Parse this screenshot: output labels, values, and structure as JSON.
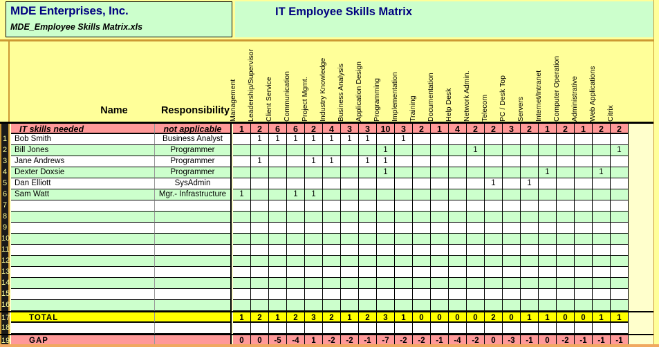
{
  "header": {
    "company_name": "MDE Enterprises, Inc.",
    "file_name": "MDE_Employee Skills Matrix.xls",
    "matrix_title": "IT Employee Skills Matrix"
  },
  "columns": {
    "name_label": "Name",
    "responsibility_label": "Responsibility",
    "skills": [
      "Management",
      "Leadership/Supervisor",
      "Client Service",
      "Communication",
      "Project Mgmt.",
      "Industry Knowledge",
      "Business Analysis",
      "Application Design",
      "Programming",
      "Implementation",
      "Training",
      "Documentation",
      "Help Desk",
      "Network Admin.",
      "Telecom",
      "PC / Desk Top",
      "Servers",
      "Internet/Intranet",
      "Computer Operation",
      "Administrative",
      "Web Applications",
      "Citrix"
    ]
  },
  "needed_row": {
    "row_number": "",
    "name": "IT skills needed",
    "responsibility": "not applicable",
    "values": [
      "1",
      "2",
      "6",
      "6",
      "2",
      "4",
      "3",
      "3",
      "10",
      "3",
      "2",
      "1",
      "4",
      "2",
      "2",
      "3",
      "2",
      "1",
      "2",
      "1",
      "2",
      "2"
    ]
  },
  "employees": [
    {
      "row_number": "1",
      "name": "Bob Smith",
      "responsibility": "Business Analyst",
      "values": [
        "",
        "1",
        "1",
        "1",
        "1",
        "1",
        "1",
        "1",
        "",
        "1",
        "",
        "",
        "",
        "",
        "",
        "",
        "",
        "",
        "",
        "",
        "",
        ""
      ]
    },
    {
      "row_number": "2",
      "name": "Bill Jones",
      "responsibility": "Programmer",
      "values": [
        "",
        "",
        "",
        "",
        "",
        "",
        "",
        "",
        "1",
        "",
        "",
        "",
        "",
        "1",
        "",
        "",
        "",
        "",
        "",
        "",
        "",
        "1"
      ]
    },
    {
      "row_number": "3",
      "name": "Jane Andrews",
      "responsibility": "Programmer",
      "values": [
        "",
        "1",
        "",
        "",
        "1",
        "1",
        "",
        "1",
        "1",
        "",
        "",
        "",
        "",
        "",
        "",
        "",
        "",
        "",
        "",
        "",
        "",
        ""
      ]
    },
    {
      "row_number": "4",
      "name": "Dexter Doxsie",
      "responsibility": "Programmer",
      "values": [
        "",
        "",
        "",
        "",
        "",
        "",
        "",
        "",
        "1",
        "",
        "",
        "",
        "",
        "",
        "",
        "",
        "",
        "1",
        "",
        "",
        "1",
        ""
      ]
    },
    {
      "row_number": "5",
      "name": "Dan Elliott",
      "responsibility": "SysAdmin",
      "values": [
        "",
        "",
        "",
        "",
        "",
        "",
        "",
        "",
        "",
        "",
        "",
        "",
        "",
        "",
        "1",
        "",
        "1",
        "",
        "",
        "",
        "",
        ""
      ]
    },
    {
      "row_number": "6",
      "name": "Sam Watt",
      "responsibility": "Mgr.- Infrastructure",
      "values": [
        "1",
        "",
        "",
        "1",
        "1",
        "",
        "",
        "",
        "",
        "",
        "",
        "",
        "",
        "",
        "",
        "",
        "",
        "",
        "",
        "",
        "",
        ""
      ]
    }
  ],
  "empty_rows": [
    "7",
    "8",
    "9",
    "10",
    "11",
    "12",
    "13",
    "14",
    "15",
    "16"
  ],
  "total_row": {
    "row_number": "17",
    "name": "TOTAL",
    "responsibility": "",
    "values": [
      "1",
      "2",
      "1",
      "2",
      "3",
      "2",
      "1",
      "2",
      "3",
      "1",
      "0",
      "0",
      "0",
      "0",
      "2",
      "0",
      "1",
      "1",
      "0",
      "0",
      "1",
      "1"
    ]
  },
  "spacer_row": {
    "row_number": "18",
    "name": "",
    "responsibility": ""
  },
  "gap_row": {
    "row_number": "19",
    "name": "GAP",
    "responsibility": "",
    "values": [
      "0",
      "0",
      "-5",
      "-4",
      "1",
      "-2",
      "-2",
      "-1",
      "-7",
      "-2",
      "-2",
      "-1",
      "-4",
      "-2",
      "0",
      "-3",
      "-1",
      "0",
      "-2",
      "-1",
      "-1",
      "-1"
    ]
  },
  "colors": {
    "banner": "#ffff99",
    "title_box": "#ccffcc",
    "title_text": "#000080",
    "needed_row": "#ff9999",
    "total_row": "#ffff00",
    "gap_row": "#ff9999",
    "band_green": "#ccffcc",
    "gutter": "#1a1a1a",
    "gutter_text": "#ffff99",
    "frame": "#cc9933"
  }
}
